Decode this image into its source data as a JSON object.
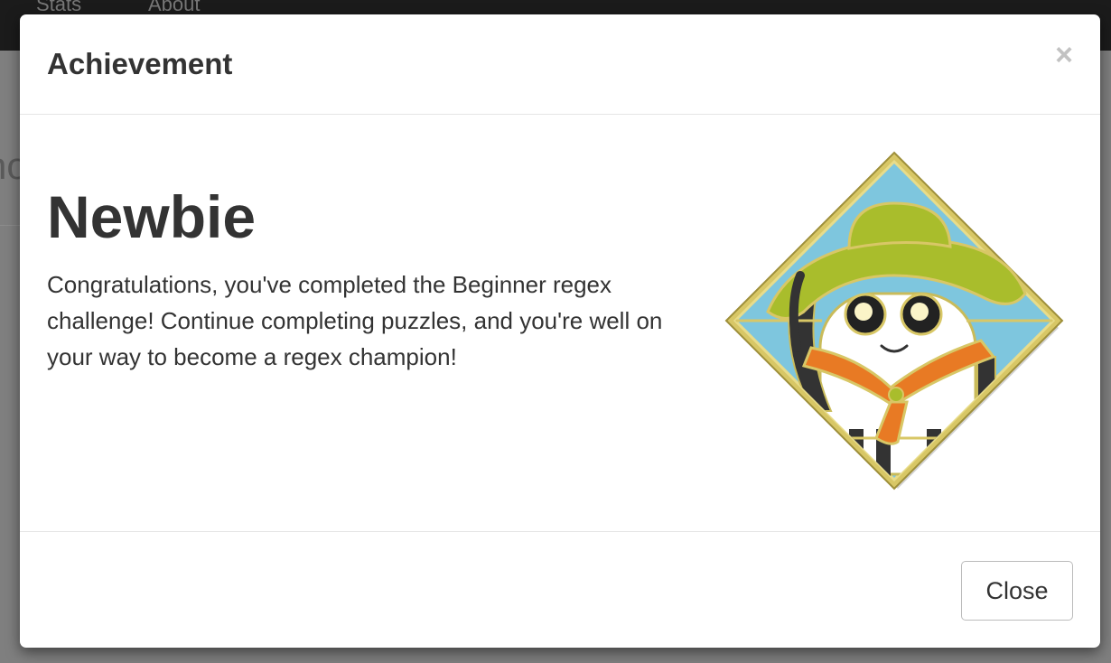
{
  "navbar": {
    "links": [
      "Stats",
      "About"
    ]
  },
  "page": {
    "heading_fragment": "no"
  },
  "modal": {
    "title": "Achievement",
    "close_glyph": "×",
    "achievement_name": "Newbie",
    "description": "Congratulations, you've completed the Beginner regex challenge! Continue completing puzzles, and you're well on your way to become a regex champion!",
    "badge_icon": "newbie-scout-badge-icon",
    "close_button_label": "Close"
  },
  "colors": {
    "badge_border": "#d8c766",
    "badge_sky": "#7ec6de",
    "hat": "#a9bd2c",
    "scarf": "#e87a24",
    "backdrop": "#7f7f7f"
  }
}
